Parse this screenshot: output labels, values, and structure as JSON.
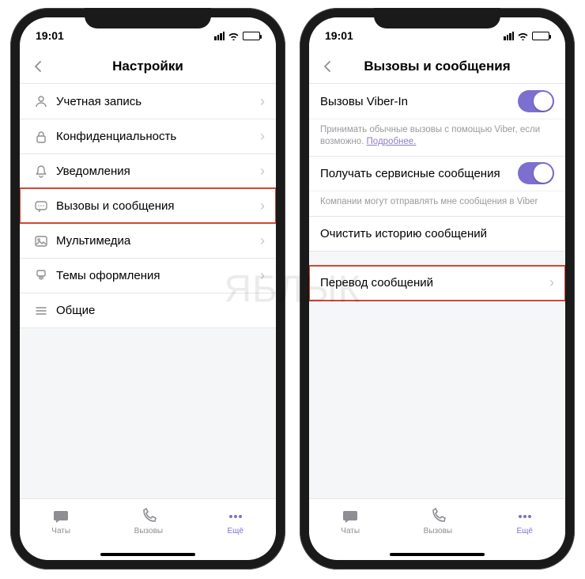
{
  "watermark": "ЯБЛЫК",
  "statusbar": {
    "time": "19:01"
  },
  "left": {
    "header_title": "Настройки",
    "items": [
      {
        "icon": "person",
        "label": "Учетная запись"
      },
      {
        "icon": "lock",
        "label": "Конфиденциальность"
      },
      {
        "icon": "bell",
        "label": "Уведомления"
      },
      {
        "icon": "chat",
        "label": "Вызовы и сообщения",
        "highlight": true
      },
      {
        "icon": "image",
        "label": "Мультимедиа"
      },
      {
        "icon": "brush",
        "label": "Темы оформления"
      },
      {
        "icon": "menu",
        "label": "Общие"
      }
    ]
  },
  "right": {
    "header_title": "Вызовы и сообщения",
    "viber_in": {
      "label": "Вызовы Viber-In",
      "desc": "Принимать обычные вызовы с помощью Viber, если возможно.",
      "link": "Подробнее."
    },
    "service_msgs": {
      "label": "Получать сервисные сообщения",
      "desc": "Компании могут отправлять мне сообщения в Viber"
    },
    "clear_history": "Очистить историю сообщений",
    "translate": "Перевод сообщений"
  },
  "tabbar": {
    "chats": "Чаты",
    "calls": "Вызовы",
    "more": "Ещё"
  }
}
